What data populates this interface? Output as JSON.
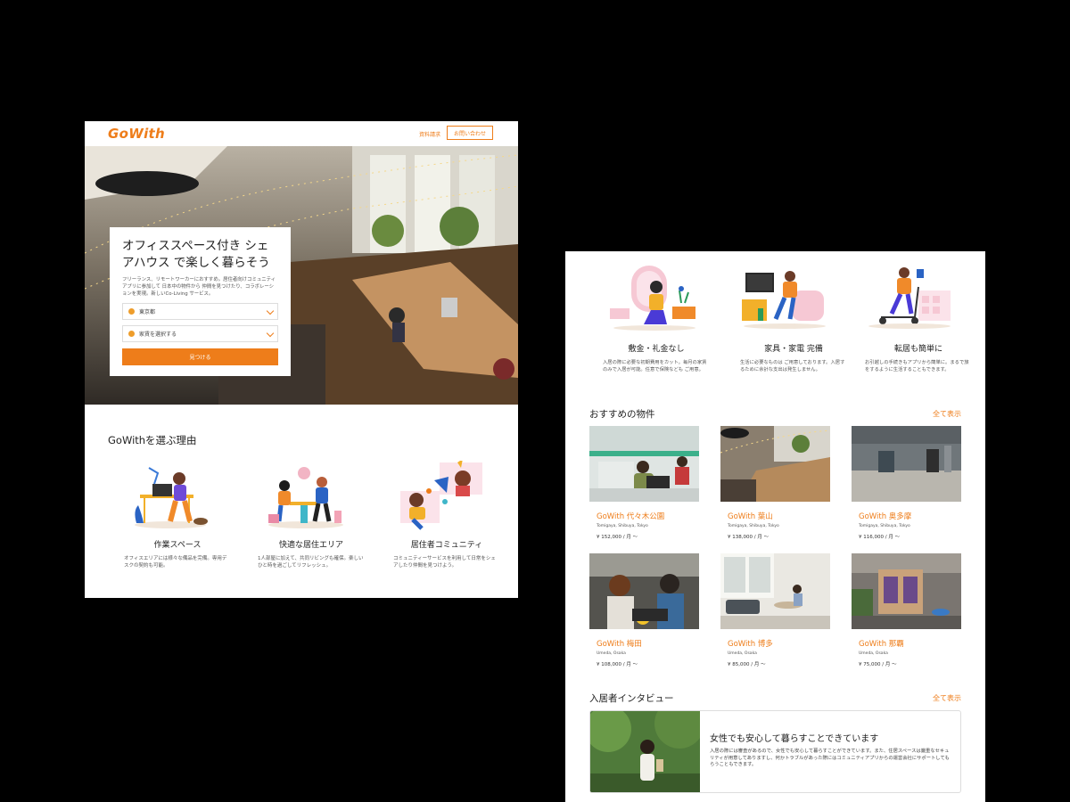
{
  "header": {
    "logo": "GoWith",
    "brochure_link": "資料請求",
    "contact_button": "お問い合わせ"
  },
  "hero": {
    "title": "オフィススペース付き シェアハウス で楽しく暮らそう",
    "description": "フリーランス、リモートワーカーにおすすめ。居住者向けコミュニティアプリに参加して 日本中の物件から 仲間を見つけたり、コラボレーションを実現。新しいCo-Living サービス。",
    "location_value": "東京都",
    "rent_placeholder": "家賃を選択する",
    "find_button": "見つける"
  },
  "reasons": {
    "title": "GoWithを選ぶ理由",
    "items": [
      {
        "title": "作業スペース",
        "desc": "オフィスエリアには様々な備品を完備。専用デスクの契約も可能。"
      },
      {
        "title": "快適な居住エリア",
        "desc": "1人部屋に加えて、共同リビングも確保。楽しいひと時を過ごしてリフレッシュ。"
      },
      {
        "title": "居住者コミュニティ",
        "desc": "コミュニティーサービスを利用して日常をシェアしたり仲間を見つけよう。"
      }
    ]
  },
  "benefits": [
    {
      "title": "敷金・礼金なし",
      "desc": "入居の際に必要な初期費用をカット。毎月の家賃のみで入居が可能。任意で保険なども ご用意。"
    },
    {
      "title": "家具・家電 完備",
      "desc": "生活に必要なものは ご用意しております。入居するために余計な支出は発生しません。"
    },
    {
      "title": "転居も簡単に",
      "desc": "お引越しの手続きもアプリから簡単に。まるで旅をするように生活することもできます。"
    }
  ],
  "recommended": {
    "title": "おすすめの物件",
    "view_all": "全て表示",
    "properties": [
      {
        "name": "GoWith 代々木公園",
        "location": "Tomigaya, Shibuya, Tokyo",
        "price": "¥ 152,000 / 月 〜"
      },
      {
        "name": "GoWith 葉山",
        "location": "Tomigaya, Shibuya, Tokyo",
        "price": "¥ 138,000 / 月 〜"
      },
      {
        "name": "GoWith 奥多摩",
        "location": "Tomigaya, Shibuya, Tokyo",
        "price": "¥ 116,000 / 月 〜"
      },
      {
        "name": "GoWith 梅田",
        "location": "Umeda, Osaka",
        "price": "¥ 108,000 / 月 〜"
      },
      {
        "name": "GoWith 博多",
        "location": "Umeda, Osaka",
        "price": "¥ 85,000 / 月 〜"
      },
      {
        "name": "GoWith 那覇",
        "location": "Umeda, Osaka",
        "price": "¥ 75,000 / 月 〜"
      }
    ]
  },
  "interviews": {
    "title": "入居者インタビュー",
    "view_all": "全て表示",
    "item": {
      "title": "女性でも安心して暮らすことできています",
      "desc": "入居の際には審査があるので、女性でも安心して暮らすことができています。また、住居スペースは厳重なセキュリティが用意してありますし、何かトラブルがあった際にはコミュニティアプリからの運営会社にサポートしてもらうこともできます。"
    }
  },
  "colors": {
    "accent": "#ee7d1a",
    "background": "#000000"
  }
}
